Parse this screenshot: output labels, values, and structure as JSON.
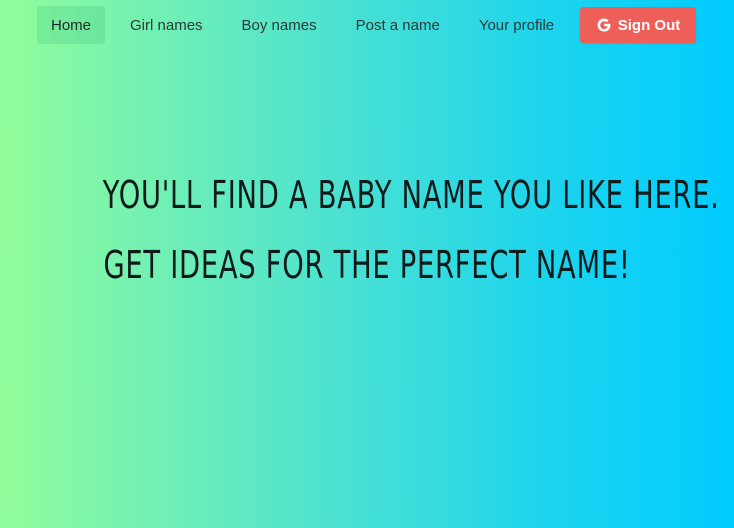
{
  "nav": {
    "items": [
      {
        "label": "Home",
        "active": true
      },
      {
        "label": "Girl names",
        "active": false
      },
      {
        "label": "Boy names",
        "active": false
      },
      {
        "label": "Post a name",
        "active": false
      },
      {
        "label": "Your profile",
        "active": false
      }
    ],
    "signout": {
      "label": "Sign Out",
      "icon": "google-icon",
      "color": "#ef5f5a"
    }
  },
  "hero": {
    "line1": "You'll find a baby name you like here.",
    "line2": "Get ideas for the perfect name!"
  },
  "colors": {
    "gradient_start": "#92fd9a",
    "gradient_end": "#00ccff"
  }
}
